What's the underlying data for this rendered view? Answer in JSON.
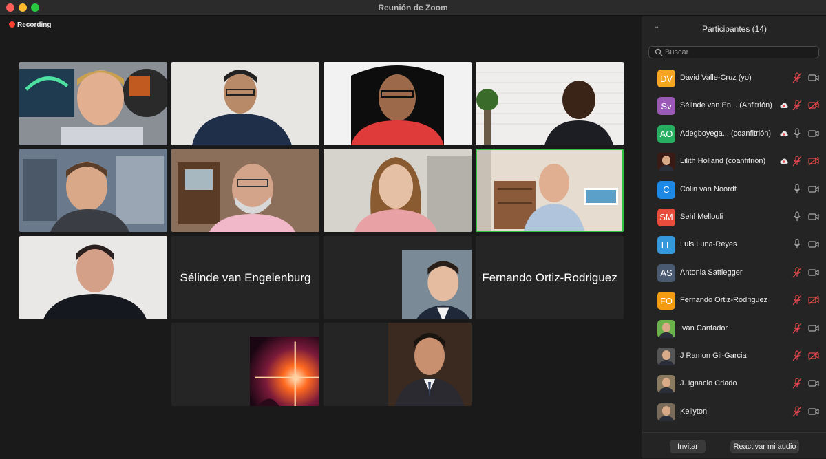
{
  "window": {
    "title": "Reunión de Zoom",
    "traffic_lights": [
      "close",
      "minimize",
      "zoom"
    ]
  },
  "stage": {
    "recording_label": "Recording",
    "tiles": [
      {
        "kind": "video",
        "person": "man-blond"
      },
      {
        "kind": "video",
        "person": "man-glasses-jacket"
      },
      {
        "kind": "video",
        "person": "man-red-shirt"
      },
      {
        "kind": "video",
        "person": "man-headset"
      },
      {
        "kind": "video",
        "person": "man-fantasy-bg"
      },
      {
        "kind": "video",
        "person": "man-grey-beard"
      },
      {
        "kind": "video",
        "person": "woman-striped-shirt"
      },
      {
        "kind": "video",
        "person": "man-office",
        "active_speaker": true
      },
      {
        "kind": "video",
        "person": "man-dark-shirt"
      },
      {
        "kind": "name",
        "label": "Sélinde van Engelenburg"
      },
      {
        "kind": "avatar",
        "person": "man-suit-photo"
      },
      {
        "kind": "name",
        "label": "Fernando Ortiz-Rodriguez"
      },
      {
        "kind": "avatar",
        "person": "star-burst-image"
      },
      {
        "kind": "avatar",
        "person": "man-suit-portrait"
      }
    ]
  },
  "panel": {
    "title": "Participantes (14)",
    "search_placeholder": "Buscar",
    "participants": [
      {
        "name": "David Valle-Cruz (yo)",
        "initials": "DV",
        "color": "#f5a623",
        "cloud": false,
        "mic": "muted",
        "cam": "on"
      },
      {
        "name": "Sélinde van En...   (Anfitrión)",
        "initials": "Sv",
        "color": "#9b59b6",
        "cloud": true,
        "mic": "muted",
        "cam": "off"
      },
      {
        "name": "Adegboyega...   (coanfitrión)",
        "initials": "AO",
        "color": "#27ae60",
        "cloud": true,
        "mic": "on",
        "cam": "on"
      },
      {
        "name": "Lilith Holland (coanfitrión)",
        "initials": "",
        "color": "#3a1a14",
        "cloud": true,
        "mic": "muted",
        "cam": "off"
      },
      {
        "name": "Colin van Noordt",
        "initials": "C",
        "color": "#1e88e5",
        "cloud": false,
        "mic": "on",
        "cam": "on"
      },
      {
        "name": "Sehl Mellouli",
        "initials": "SM",
        "color": "#e74c3c",
        "cloud": false,
        "mic": "on",
        "cam": "on"
      },
      {
        "name": "Luis Luna-Reyes",
        "initials": "LL",
        "color": "#3498db",
        "cloud": false,
        "mic": "on",
        "cam": "on"
      },
      {
        "name": "Antonia Sattlegger",
        "initials": "AS",
        "color": "#4a5a70",
        "cloud": false,
        "mic": "muted",
        "cam": "on"
      },
      {
        "name": "Fernando Ortiz-Rodriguez",
        "initials": "FO",
        "color": "#f39c12",
        "cloud": false,
        "mic": "muted",
        "cam": "off"
      },
      {
        "name": "Iván Cantador",
        "initials": "",
        "color": "#6ab04c",
        "cloud": false,
        "mic": "muted",
        "cam": "on"
      },
      {
        "name": "J Ramon Gil-Garcia",
        "initials": "",
        "color": "#555555",
        "cloud": false,
        "mic": "muted",
        "cam": "off"
      },
      {
        "name": "J. Ignacio Criado",
        "initials": "",
        "color": "#8a7a60",
        "cloud": false,
        "mic": "muted",
        "cam": "on"
      },
      {
        "name": "Kellyton",
        "initials": "",
        "color": "#7a6a5a",
        "cloud": false,
        "mic": "muted",
        "cam": "on"
      }
    ],
    "invite_label": "Invitar",
    "unmute_label": "Reactivar mi audio"
  }
}
